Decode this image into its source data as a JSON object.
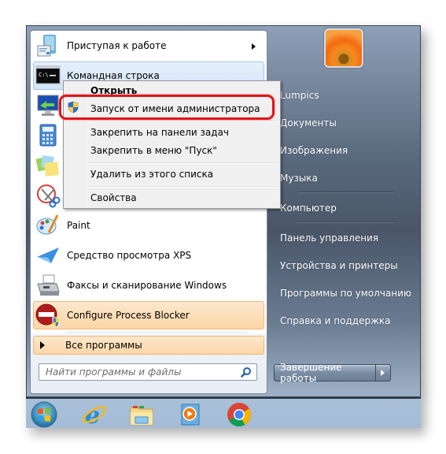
{
  "start_menu": {
    "pinned_and_recent": [
      {
        "label": "Приступая к работе",
        "icon": "getting-started-icon",
        "has_submenu": true
      },
      {
        "label": "Командная строка",
        "icon": "command-prompt-icon",
        "state": "hover"
      },
      {
        "label": "",
        "icon": "remote-desktop-icon"
      },
      {
        "label": "",
        "icon": "calculator-icon"
      },
      {
        "label": "",
        "icon": "sticky-notes-icon"
      },
      {
        "label": "",
        "icon": "snipping-tool-icon"
      },
      {
        "label": "Paint",
        "icon": "paint-icon"
      },
      {
        "label": "Средство просмотра XPS",
        "icon": "xps-viewer-icon"
      },
      {
        "label": "Факсы и сканирование Windows",
        "icon": "fax-scan-icon"
      },
      {
        "label": "Configure Process Blocker",
        "icon": "process-blocker-icon",
        "state": "new-program"
      }
    ],
    "all_programs_label": "Все программы",
    "search": {
      "placeholder": "Найти программы и файлы",
      "value": ""
    },
    "user_picture": "flower-avatar",
    "right_links": [
      "Lumpics",
      "Документы",
      "Изображения",
      "Музыка",
      "Компьютер",
      "Панель управления",
      "Устройства и принтеры",
      "Программы по умолчанию",
      "Справка и поддержка"
    ],
    "shutdown_label": "Завершение работы"
  },
  "context_menu": {
    "items": [
      {
        "label": "Открыть",
        "bold": true
      },
      {
        "label": "Запуск от имени администратора",
        "icon": "uac-shield-icon",
        "highlighted": true
      },
      {
        "label": "Закрепить на панели задач"
      },
      {
        "label": "Закрепить в меню \"Пуск\""
      },
      {
        "label": "Удалить из этого списка"
      },
      {
        "label": "Свойства"
      }
    ]
  },
  "taskbar": {
    "items": [
      "start-orb",
      "internet-explorer",
      "windows-explorer",
      "media-player",
      "google-chrome"
    ]
  },
  "colors": {
    "highlight_ring": "#e3141b",
    "hover_item": "#d3e5f9",
    "new_program": "#fbd6a6"
  }
}
